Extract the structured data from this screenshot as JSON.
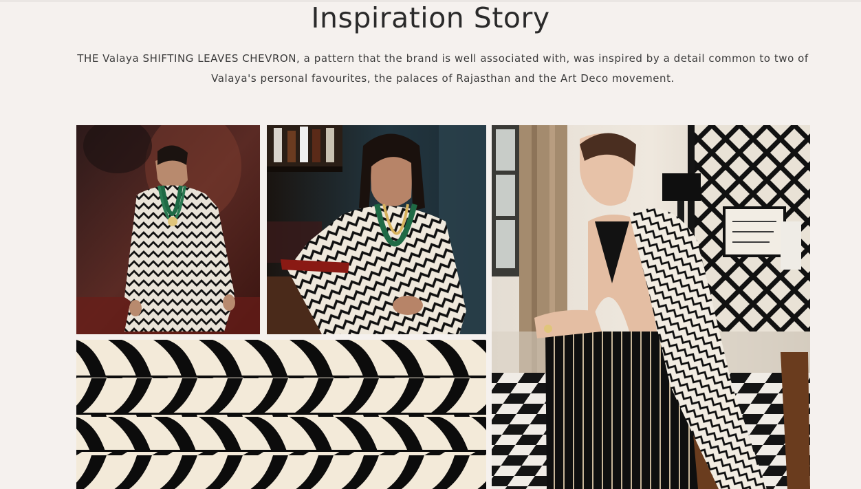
{
  "section": {
    "title": "Inspiration Story",
    "description": "THE Valaya SHIFTING LEAVES CHEVRON, a pattern that the brand is well associated with, was inspired by a detail common to two of Valaya's personal favourites, the palaces of Rajasthan and the Art Deco movement."
  },
  "colors": {
    "background": "#f5f1ee",
    "title_text": "#2a2a2a",
    "body_text": "#3a3a3a",
    "pattern_black": "#0c0c0c",
    "pattern_cream": "#f3ead9"
  },
  "gallery": {
    "images": [
      {
        "id": "runway",
        "subject": "model on runway in black and white chevron kurta with layered emerald necklaces"
      },
      {
        "id": "bar",
        "subject": "model seated at bar in black and white chevron outfit with emerald necklaces"
      },
      {
        "id": "seated",
        "subject": "model seated in palace interior wearing black striped gown with chevron drape"
      },
      {
        "id": "pattern",
        "subject": "close-up of black and cream shifting leaves chevron textile"
      }
    ]
  }
}
